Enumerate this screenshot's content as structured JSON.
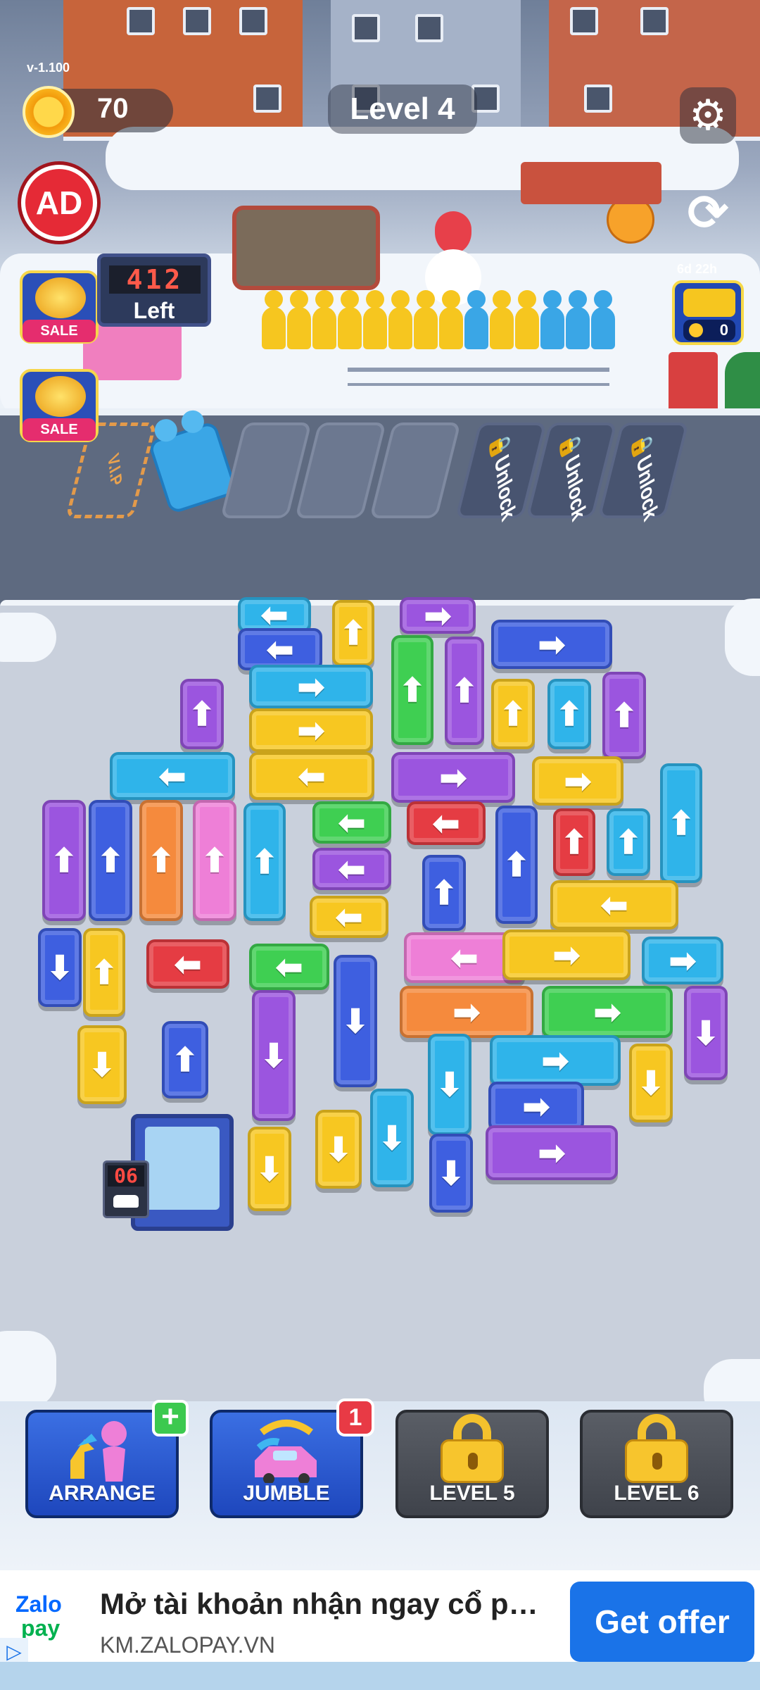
{
  "hud": {
    "version": "v-1.100",
    "coins": "70",
    "level_title": "Level 4",
    "settings_icon": "gear-icon",
    "ad_label": "AD",
    "refresh_icon": "refresh-icon",
    "event_timer": "6d 22h",
    "bus_count": "0",
    "sale_1": "SALE",
    "sale_2": "SALE"
  },
  "queue": {
    "remaining_digits": "412",
    "remaining_label": "Left",
    "people_colors": [
      "#f6c61f",
      "#f6c61f",
      "#f6c61f",
      "#f6c61f",
      "#f6c61f",
      "#f6c61f",
      "#f6c61f",
      "#f6c61f",
      "#3aa6e6",
      "#f6c61f",
      "#f6c61f",
      "#3aa6e6",
      "#3aa6e6",
      "#3aa6e6"
    ]
  },
  "parking": {
    "vip_label": "V.I.P",
    "unlock_label": "🔒Unlock",
    "free_slots": 3,
    "locked_slots": 3
  },
  "garage": {
    "count": "06"
  },
  "boosters": {
    "arrange_label": "ARRANGE",
    "arrange_badge": "+",
    "jumble_label": "JUMBLE",
    "jumble_badge": "1",
    "level5_label": "LEVEL 5",
    "level6_label": "LEVEL 6"
  },
  "ad": {
    "brand_line1": "Zalo",
    "brand_line2": "pay",
    "title": "Mở tài khoản nhận ngay cổ phi...",
    "url": "KM.ZALOPAY.VN",
    "cta": "Get offer"
  },
  "colors": {
    "purple": "#9b55df",
    "blue": "#3e5fe0",
    "cyan": "#2fb4ea",
    "yellow": "#f7c721",
    "green": "#3fcf52",
    "red": "#e53c43",
    "orange": "#f58a3d",
    "pink": "#ee7fd7"
  },
  "vehicles": [
    {
      "color": "cyan",
      "dir": "left"
    },
    {
      "color": "yellow",
      "dir": "up"
    },
    {
      "color": "purple",
      "dir": "right"
    },
    {
      "color": "blue",
      "dir": "right"
    },
    {
      "color": "blue",
      "dir": "left"
    },
    {
      "color": "purple",
      "dir": "up"
    },
    {
      "color": "cyan",
      "dir": "right"
    },
    {
      "color": "green",
      "dir": "up"
    },
    {
      "color": "purple",
      "dir": "up"
    },
    {
      "color": "yellow",
      "dir": "up"
    },
    {
      "color": "cyan",
      "dir": "up"
    },
    {
      "color": "purple",
      "dir": "up"
    },
    {
      "color": "yellow",
      "dir": "right"
    },
    {
      "color": "cyan",
      "dir": "left"
    },
    {
      "color": "yellow",
      "dir": "left"
    },
    {
      "color": "purple",
      "dir": "right"
    },
    {
      "color": "yellow",
      "dir": "right"
    },
    {
      "color": "cyan",
      "dir": "up"
    },
    {
      "color": "purple",
      "dir": "up"
    },
    {
      "color": "blue",
      "dir": "up"
    },
    {
      "color": "orange",
      "dir": "up"
    },
    {
      "color": "pink",
      "dir": "up"
    },
    {
      "color": "cyan",
      "dir": "up"
    },
    {
      "color": "green",
      "dir": "left"
    },
    {
      "color": "red",
      "dir": "left"
    },
    {
      "color": "blue",
      "dir": "up"
    },
    {
      "color": "red",
      "dir": "up"
    },
    {
      "color": "cyan",
      "dir": "up"
    },
    {
      "color": "purple",
      "dir": "left"
    },
    {
      "color": "blue",
      "dir": "up"
    },
    {
      "color": "yellow",
      "dir": "left"
    },
    {
      "color": "yellow",
      "dir": "left"
    },
    {
      "color": "blue",
      "dir": "down"
    },
    {
      "color": "yellow",
      "dir": "up"
    },
    {
      "color": "red",
      "dir": "left"
    },
    {
      "color": "green",
      "dir": "left"
    },
    {
      "color": "blue",
      "dir": "down"
    },
    {
      "color": "pink",
      "dir": "left"
    },
    {
      "color": "yellow",
      "dir": "right"
    },
    {
      "color": "cyan",
      "dir": "right"
    },
    {
      "color": "orange",
      "dir": "right"
    },
    {
      "color": "green",
      "dir": "right"
    },
    {
      "color": "purple",
      "dir": "down"
    },
    {
      "color": "yellow",
      "dir": "down"
    },
    {
      "color": "blue",
      "dir": "up"
    },
    {
      "color": "purple",
      "dir": "down"
    },
    {
      "color": "cyan",
      "dir": "down"
    },
    {
      "color": "cyan",
      "dir": "right"
    },
    {
      "color": "blue",
      "dir": "right"
    },
    {
      "color": "yellow",
      "dir": "down"
    },
    {
      "color": "yellow",
      "dir": "down"
    },
    {
      "color": "yellow",
      "dir": "down"
    },
    {
      "color": "cyan",
      "dir": "down"
    },
    {
      "color": "blue",
      "dir": "down"
    },
    {
      "color": "purple",
      "dir": "right"
    }
  ]
}
